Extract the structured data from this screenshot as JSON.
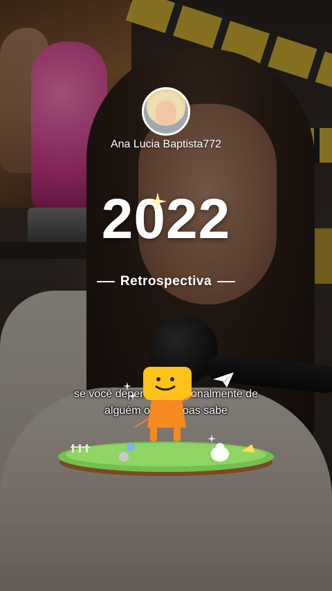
{
  "profile": {
    "username": "Ana Lucia Baptista772"
  },
  "recap": {
    "year": "2022",
    "label": "Retrospectiva"
  },
  "subtitle": {
    "line1": "se você depende emocionalmente de",
    "line2": "alguém ou pessoas sabe"
  },
  "colors": {
    "text": "#ffffff",
    "character_orange": "#f5a623",
    "grass": "#7cc65b"
  },
  "icons": [
    "sparkle-icon",
    "paper-plane-icon",
    "character-illustration",
    "island-illustration"
  ]
}
